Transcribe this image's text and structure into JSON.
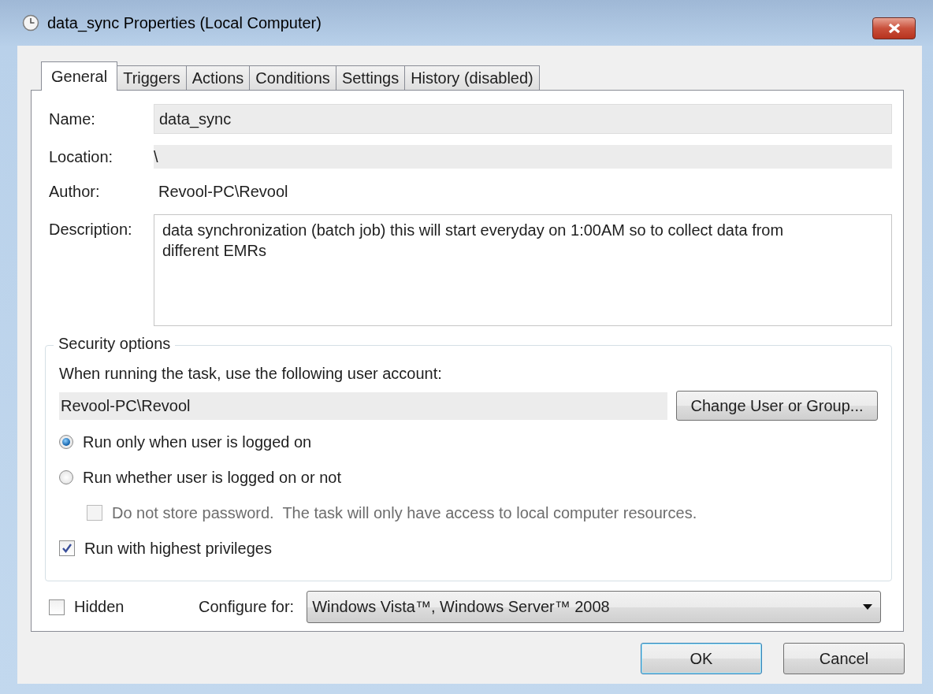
{
  "window": {
    "title": "data_sync Properties (Local Computer)"
  },
  "tabs": [
    {
      "label": "General",
      "selected": true
    },
    {
      "label": "Triggers",
      "selected": false
    },
    {
      "label": "Actions",
      "selected": false
    },
    {
      "label": "Conditions",
      "selected": false
    },
    {
      "label": "Settings",
      "selected": false
    },
    {
      "label": "History (disabled)",
      "selected": false
    }
  ],
  "fields": [
    {
      "kind": "input",
      "label": "Name:",
      "value": "data_sync"
    },
    {
      "kind": "readonly",
      "label": "Location:",
      "value": "\\"
    },
    {
      "kind": "text",
      "label": "Author:",
      "value": "Revool-PC\\Revool"
    },
    {
      "kind": "textarea",
      "label": "Description:",
      "value": "data synchronization (batch job) this will start everyday on 1:00AM so to collect data from different EMRs"
    }
  ],
  "security": {
    "title": "Security options",
    "prompt": "When running the task, use the following user account:",
    "account": "Revool-PC\\Revool",
    "change_button": "Change User or Group...",
    "options": [
      {
        "kind": "radio",
        "label": "Run only when user is logged on",
        "selected": true,
        "disabled": false
      },
      {
        "kind": "radio",
        "label": "Run whether user is logged on or not",
        "selected": false,
        "disabled": false
      },
      {
        "kind": "checkbox",
        "label": "Do not store password.  The task will only have access to local computer resources.",
        "checked": false,
        "disabled": true
      },
      {
        "kind": "checkbox",
        "label": "Run with highest privileges",
        "checked": true,
        "disabled": false
      }
    ]
  },
  "hidden": {
    "label": "Hidden",
    "checked": false
  },
  "configure": {
    "label": "Configure for:",
    "value": "Windows Vista™, Windows Server™ 2008"
  },
  "buttons": [
    {
      "label": "OK",
      "default": true
    },
    {
      "label": "Cancel",
      "default": false
    }
  ]
}
